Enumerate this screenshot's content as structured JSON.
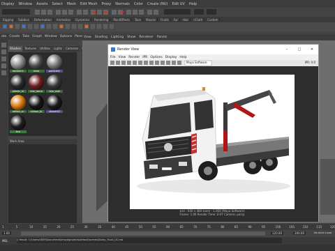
{
  "main_menu": [
    "Display",
    "Window",
    "Assets",
    "Select",
    "Mesh",
    "Edit Mesh",
    "Proxy",
    "Normals",
    "Color",
    "Create (NU)",
    "Edit UV",
    "Help"
  ],
  "shelf_tabs": [
    "Rigging",
    "Subdivs",
    "Deformation",
    "Animation",
    "Dynamics",
    "Rendering",
    "PaintEffects",
    "Toon",
    "Muscle",
    "Fluids",
    "Fur",
    "Hair",
    "nCloth",
    "Custom"
  ],
  "hypershade": {
    "menu": [
      "ate",
      "Create",
      "Tabs",
      "Graph",
      "Window",
      "Options",
      "Panels"
    ],
    "tabs": [
      "Shaders",
      "Textures",
      "Utilities",
      "Lights",
      "Cameras",
      "Shad"
    ],
    "swatches": [
      {
        "label": "lambert1",
        "color": "#8a8a8a"
      },
      {
        "label": "lamb",
        "color": "#4a4a4a"
      },
      {
        "label": "particleCl",
        "color": "#777777"
      },
      {
        "label": "plastic_m",
        "color": "#2a2a2a"
      },
      {
        "label": "rear_lamp",
        "color": "#702020"
      },
      {
        "label": "rear_mat",
        "color": "#3a3a3a"
      },
      {
        "label": "reflect_or",
        "color": "#d97a10"
      },
      {
        "label": "rubber_bl",
        "color": "#151515"
      },
      {
        "label": "shaderGl",
        "color": "#1a1a1a"
      },
      {
        "label": "tire",
        "color": "#1e1e1e"
      }
    ],
    "uv_label": "Work Area"
  },
  "viewport_menu": [
    "View",
    "Shading",
    "Lighting",
    "Show",
    "Renderer",
    "Panels"
  ],
  "render_view": {
    "title": "Render View",
    "menu": [
      "File",
      "View",
      "Render",
      "IPR",
      "Options",
      "Display",
      "Help"
    ],
    "renderer": "Maya Software",
    "ipr": "IPR: 0:0",
    "info_line1": "size : 640 x 480   zoom : 1.000   (Maya Software)",
    "info_line2": "Frame: 1.00   Render Time: 0:07   Camera: persp"
  },
  "timeline": {
    "ticks": [
      "1",
      "5",
      "10",
      "15",
      "20",
      "25",
      "30",
      "35",
      "40",
      "45",
      "50",
      "55",
      "60",
      "65",
      "70",
      "75",
      "80",
      "85",
      "90",
      "95",
      "100",
      "105",
      "110",
      "115",
      "120"
    ]
  },
  "range": {
    "start": "1.00",
    "end": "120.00",
    "end2": "200.00",
    "anim_layer": "No Anim Layer"
  },
  "command_line": "// Result: C:/Users/USER/Documents/maya/projects/default/scenes/Dump_Truck_UC.mb",
  "mode": "MEL"
}
